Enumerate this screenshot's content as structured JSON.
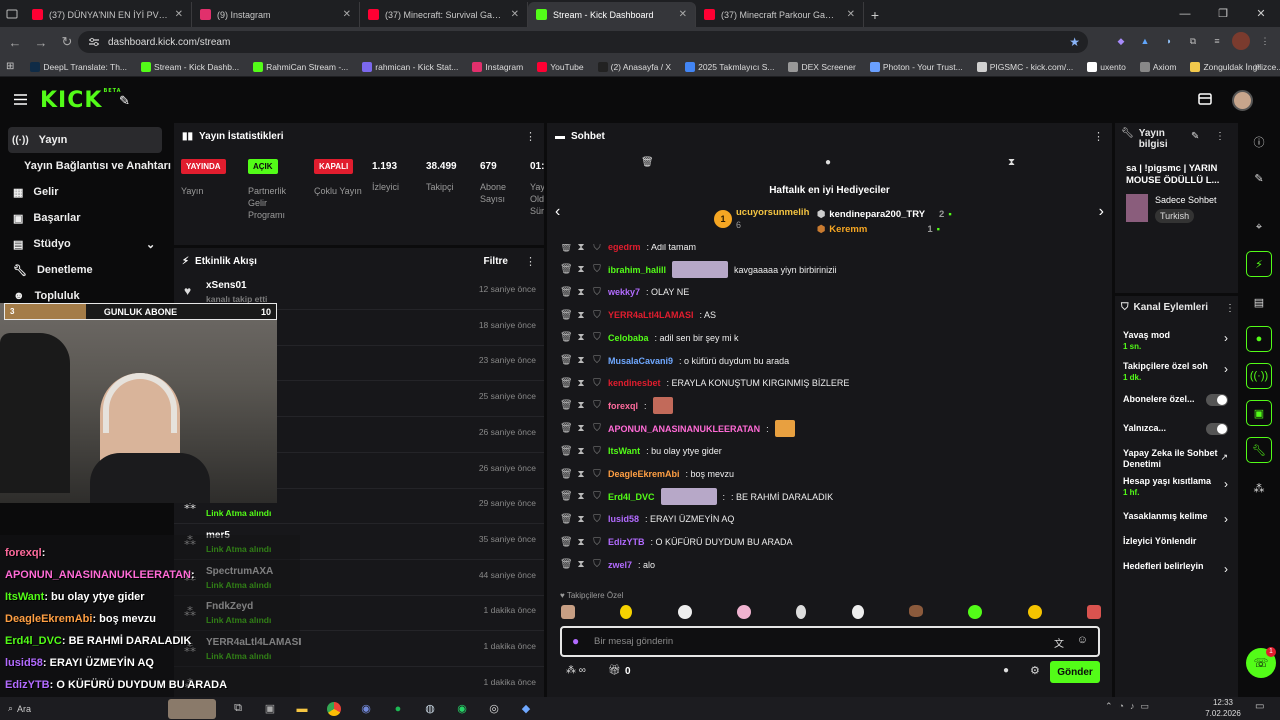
{
  "browser": {
    "tabs": [
      {
        "title": "(37) DÜNYA'NIN EN İYİ PVPCİSİ",
        "color": "#ff0033",
        "active": false
      },
      {
        "title": "(9) Instagram",
        "color": "#e1306c",
        "active": false
      },
      {
        "title": "(37) Minecraft: Survival Gamesi",
        "color": "#ff0033",
        "active": false
      },
      {
        "title": "Stream - Kick Dashboard",
        "color": "#53fc18",
        "active": true
      },
      {
        "title": "(37) Minecraft Parkour Gameple",
        "color": "#ff0033",
        "active": false
      }
    ],
    "url": "dashboard.kick.com/stream",
    "bookmarks": [
      {
        "label": "DeepL Translate: Th...",
        "color": "#0f2b46"
      },
      {
        "label": "Stream - Kick Dashb...",
        "color": "#53fc18"
      },
      {
        "label": "RahmiCan Stream -...",
        "color": "#53fc18"
      },
      {
        "label": "rahmican - Kick Stat...",
        "color": "#7b68ee"
      },
      {
        "label": "Instagram",
        "color": "#e1306c"
      },
      {
        "label": "YouTube",
        "color": "#ff0033"
      },
      {
        "label": "(2) Anasayfa / X",
        "color": "#222222"
      },
      {
        "label": "2025 Takmlayıcı S...",
        "color": "#4285f4"
      },
      {
        "label": "DEX Screener",
        "color": "#999999"
      },
      {
        "label": "Photon - Your Trust...",
        "color": "#6aa0ff"
      },
      {
        "label": "PIGSMC - kick.com/...",
        "color": "#d0d0d0"
      },
      {
        "label": "uxento",
        "color": "#ffffff"
      },
      {
        "label": "Axiom",
        "color": "#888888"
      },
      {
        "label": "Zonguldak İngilizce...",
        "color": "#f2c94c"
      }
    ]
  },
  "kick": {
    "logo": "KICK",
    "beta": "BETA",
    "sidebar": [
      {
        "label": "Yayın",
        "icon": "broadcast-icon",
        "active": true
      },
      {
        "label": "Yayın Bağlantısı ve Anahtarı",
        "icon": "",
        "active": false
      },
      {
        "label": "Gelir",
        "icon": "revenue-icon",
        "active": false
      },
      {
        "label": "Başarılar",
        "icon": "achievements-icon",
        "active": false
      },
      {
        "label": "Stüdyo",
        "icon": "studio-icon",
        "active": false
      },
      {
        "label": "Denetleme",
        "icon": "moderation-icon",
        "active": false
      },
      {
        "label": "Topluluk",
        "icon": "community-icon",
        "active": false
      }
    ],
    "stats": {
      "title": "Yayın İstatistikleri",
      "badges": [
        {
          "badge": "YAYINDA",
          "label": "Yayın",
          "color": "#e11d2e"
        },
        {
          "badge": "AÇIK",
          "label": "Partnerlik Gelir Programı",
          "color": "#53fc18"
        },
        {
          "badge": "KAPALI",
          "label": "Çoklu Yayın",
          "color": "#e11d2e"
        }
      ],
      "numbers": [
        {
          "value": "1.193",
          "label": "İzleyici"
        },
        {
          "value": "38.499",
          "label": "Takipçi"
        },
        {
          "value": "679",
          "label": "Abone Sayısı"
        },
        {
          "value": "01:",
          "label": "Yay Old Sür"
        }
      ]
    },
    "activity": {
      "title": "Etkinlik Akışı",
      "filter": "Filtre",
      "items": [
        {
          "name": "xSens01",
          "sub": "kanalı takip etti",
          "time": "12 saniye önce"
        },
        {
          "name": "Sultatxd",
          "sub": "",
          "time": "18 saniye önce"
        },
        {
          "name": "",
          "sub": "",
          "time": "23 saniye önce"
        },
        {
          "name": "",
          "sub": "",
          "time": "25 saniye önce"
        },
        {
          "name": "",
          "sub": "",
          "time": "26 saniye önce"
        },
        {
          "name": "",
          "sub": "Link Atma alındı",
          "time": "26 saniye önce"
        },
        {
          "name": "AluanzL",
          "sub": "Link Atma alındı",
          "time": "29 saniye önce"
        },
        {
          "name": "mer5",
          "sub": "Link Atma alındı",
          "time": "35 saniye önce"
        },
        {
          "name": "SpectrumAXA",
          "sub": "Link Atma alındı",
          "time": "44 saniye önce"
        },
        {
          "name": "FndkZeyd",
          "sub": "Link Atma alındı",
          "time": "1 dakika önce"
        },
        {
          "name": "YERR4aLtl4LAMASI",
          "sub": "Link Atma alındı",
          "time": "1 dakika önce"
        },
        {
          "name": "",
          "sub": "",
          "time": "1 dakika önce"
        }
      ]
    },
    "overlay": {
      "count": "3",
      "label": "GUNLUK ABONE",
      "goal": "10",
      "chat_lines": [
        {
          "user": "forexql",
          "msg": ":",
          "color": "#ff6b9d"
        },
        {
          "user": "APONUN_ANASINANUKLEERATAN",
          "msg": ":",
          "color": "#ff6bd6"
        },
        {
          "user": "ItsWant",
          "msg": ": bu olay ytye gider",
          "color": "#53fc18"
        },
        {
          "user": "DeagleEkremAbi",
          "msg": ": boş mevzu",
          "color": "#ff9f43"
        },
        {
          "user": "Erd4l_DVC",
          "msg": ": BE RAHMİ DARALADIK",
          "color": "#53fc18"
        },
        {
          "user": "lusid58",
          "msg": ": ERAYI ÜZMEYİN AQ",
          "color": "#b26bff"
        },
        {
          "user": "EdizYTB",
          "msg": ": O KÜFÜRÜ DUYDUM BU ARADA",
          "color": "#b26bff"
        }
      ]
    },
    "chat": {
      "title": "Sohbet",
      "gifters_title": "Haftalık en iyi Hediyeciler",
      "gifters": [
        {
          "rank": "1",
          "name": "ucuyorsunmelih",
          "count": "6"
        },
        {
          "rank": "",
          "name": "kendinepara200_TRY",
          "count": "2"
        },
        {
          "rank": "",
          "name": "Keremm",
          "count": "1"
        }
      ],
      "messages": [
        {
          "user": "egedrm",
          "msg": ": Adil tamam",
          "color": "#e11d2e"
        },
        {
          "user": "ibrahim_halill",
          "msg": "kavgaaaaa yiyn birbirinizii",
          "color": "#53fc18"
        },
        {
          "user": "wekky7",
          "msg": ": OLAY NE",
          "color": "#b26bff"
        },
        {
          "user": "YERR4aLtl4LAMASI",
          "msg": ": AS",
          "color": "#e11d2e"
        },
        {
          "user": "Celobaba",
          "msg": ": adil sen bir şey mi k",
          "color": "#53fc18"
        },
        {
          "user": "MusalaCavani9",
          "msg": ": o küfürü duydum bu arada",
          "color": "#6fa8ff"
        },
        {
          "user": "kendinesbet",
          "msg": ": ERAYLA KONUŞTUM KIRGINMIŞ BİZLERE",
          "color": "#e11d2e"
        },
        {
          "user": "forexql",
          "msg": ":",
          "color": "#ff6b9d"
        },
        {
          "user": "APONUN_ANASINANUKLEERATAN",
          "msg": ":",
          "color": "#ff6bd6"
        },
        {
          "user": "ItsWant",
          "msg": ": bu olay ytye gider",
          "color": "#53fc18"
        },
        {
          "user": "DeagleEkremAbi",
          "msg": ": boş mevzu",
          "color": "#ff9f43"
        },
        {
          "user": "Erd4l_DVC",
          "msg": ":",
          "color": "#53fc18"
        },
        {
          "user": "lusid58",
          "msg": ": ERAYI ÜZMEYİN AQ",
          "color": "#b26bff"
        },
        {
          "user": "EdizYTB",
          "msg": ": O KÜFÜRÜ DUYDUM BU ARADA",
          "color": "#b26bff"
        },
        {
          "user": "zwel7",
          "msg": ": alo",
          "color": "#b26bff"
        }
      ],
      "follower_only": "Takipçilere Özel",
      "input_placeholder": "Bir mesaj gönderin",
      "points": "0",
      "send": "Gönder"
    },
    "stream_info": {
      "title": "Yayın bilgisi",
      "stream_title": "sa | !pigsmc | YARIN MOUSE ÖDÜLLÜ L...",
      "category": "Sadece Sohbet",
      "language": "Turkish"
    },
    "channel_actions": {
      "title": "Kanal Eylemleri",
      "items": [
        {
          "label": "Yavaş mod",
          "value": "1 sn.",
          "control": "chevron"
        },
        {
          "label": "Takipçilere özel soh",
          "value": "1 dk.",
          "control": "chevron"
        },
        {
          "label": "Abonelere özel...",
          "value": "",
          "control": "toggle"
        },
        {
          "label": "Yalnızca...",
          "value": "",
          "control": "toggle"
        },
        {
          "label": "Yapay Zeka ile Sohbet Denetimi",
          "value": "",
          "control": "external"
        },
        {
          "label": "Hesap yaşı kısıtlama",
          "value": "1 hf.",
          "control": "chevron"
        },
        {
          "label": "Yasaklanmış kelime",
          "value": "",
          "control": "chevron"
        },
        {
          "label": "İzleyici Yönlendir",
          "value": "",
          "control": "none"
        },
        {
          "label": "Hedefleri belirleyin",
          "value": "",
          "control": "chevron"
        }
      ]
    }
  },
  "taskbar": {
    "search": "Ara",
    "time": "12:33",
    "date": "7.02.2026"
  },
  "colors": {
    "accent": "#53fc18",
    "danger": "#e11d2e",
    "panel": "#17171a"
  }
}
